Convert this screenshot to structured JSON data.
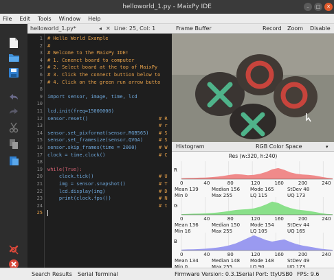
{
  "window": {
    "title": "helloworld_1.py - MaixPy IDE"
  },
  "menu": [
    "File",
    "Edit",
    "Tools",
    "Window",
    "Help"
  ],
  "editor": {
    "tab_label": "helloworld_1.py*",
    "cursor_pos": "Line: 25, Col: 1",
    "close_glyph": "✕",
    "nav_left": "◂",
    "nav_right": "▸"
  },
  "code_lines": [
    {
      "n": "1",
      "t": "# Hello World Example",
      "c": "#e8a24a"
    },
    {
      "n": "2",
      "t": "#",
      "c": "#e8a24a"
    },
    {
      "n": "3",
      "t": "# Welcome to the MaixPy IDE!",
      "c": "#e8a24a"
    },
    {
      "n": "4",
      "t": "# 1. Conenct board to computer",
      "c": "#e8a24a"
    },
    {
      "n": "5",
      "t": "# 2. Select board at the top of MaixPy",
      "c": "#e8a24a"
    },
    {
      "n": "6",
      "t": "# 3. Click the connect buttion below to",
      "c": "#e8a24a"
    },
    {
      "n": "7",
      "t": "# 4. Click on the green run arrow butto",
      "c": "#e8a24a"
    },
    {
      "n": "8",
      "t": "",
      "c": "#c0c0c0"
    },
    {
      "n": "9",
      "t": "import sensor, image, time, lcd",
      "c": "#6fa8dc"
    },
    {
      "n": "10",
      "t": "",
      "c": "#c0c0c0"
    },
    {
      "n": "11",
      "t": "lcd.init(freq=15000000)",
      "c": "#6fa8dc"
    },
    {
      "n": "12",
      "t": "sensor.reset()",
      "c": "#6fa8dc"
    },
    {
      "n": "13",
      "t": "",
      "c": "#c0c0c0"
    },
    {
      "n": "14",
      "t": "sensor.set_pixformat(sensor.RGB565)",
      "c": "#6fa8dc"
    },
    {
      "n": "15",
      "t": "sensor.set_framesize(sensor.QVGA)",
      "c": "#6fa8dc"
    },
    {
      "n": "16",
      "t": "sensor.skip_frames(time = 2000)",
      "c": "#6fa8dc"
    },
    {
      "n": "17",
      "t": "clock = time.clock()",
      "c": "#6fa8dc"
    },
    {
      "n": "18",
      "t": "",
      "c": "#c0c0c0"
    },
    {
      "n": "19",
      "t": "while(True):",
      "c": "#d06070"
    },
    {
      "n": "20",
      "t": "    clock.tick()",
      "c": "#6fa8dc"
    },
    {
      "n": "21",
      "t": "    img = sensor.snapshot()",
      "c": "#6fa8dc"
    },
    {
      "n": "22",
      "t": "    lcd.display(img)",
      "c": "#6fa8dc"
    },
    {
      "n": "23",
      "t": "    print(clock.fps())",
      "c": "#6fa8dc"
    },
    {
      "n": "24",
      "t": "",
      "c": "#c0c0c0"
    },
    {
      "n": "25",
      "t": "",
      "c": "#c0c0c0"
    }
  ],
  "trailing_comments": [
    "# R",
    "# r",
    "# S",
    "# S",
    "# W",
    "# C",
    "# U",
    "# T",
    "# D",
    "# N",
    "# t"
  ],
  "framebuffer": {
    "title": "Frame Buffer",
    "record": "Record",
    "zoom": "Zoom",
    "disable": "Disable"
  },
  "histogram": {
    "title": "Histogram",
    "colorspace": "RGB Color Space",
    "resolution": "Res (w:320, h:240)",
    "x_ticks": [
      "0",
      "40",
      "80",
      "120",
      "160",
      "200",
      "240"
    ],
    "stat_labels": [
      "Mean",
      "Median",
      "Mode",
      "StDev",
      "Min",
      "Max",
      "LQ",
      "UQ"
    ],
    "channels": [
      {
        "name": "R",
        "color": "#f08a8a",
        "mean": "139",
        "median": "156",
        "mode": "165",
        "stdev": "48",
        "min": "0",
        "max": "255",
        "lq": "115",
        "uq": "173"
      },
      {
        "name": "G",
        "color": "#8ae08a",
        "mean": "136",
        "median": "150",
        "mode": "154",
        "stdev": "44",
        "min": "16",
        "max": "255",
        "lq": "105",
        "uq": "165"
      },
      {
        "name": "B",
        "color": "#9a9af0",
        "mean": "134",
        "median": "148",
        "mode": "148",
        "stdev": "49",
        "min": "0",
        "max": "255",
        "lq": "90",
        "uq": "173"
      }
    ]
  },
  "status": {
    "search_results": "Search Results",
    "serial_terminal": "Serial Terminal",
    "firmware": "Firmware Version: 0.3.1",
    "serial_port": "Serial Port: ttyUSB0",
    "fps": "FPS:   9.6"
  },
  "colors": {
    "accent": "#2a7fd4",
    "titlebar": "#3a3a3a",
    "close": "#e05a2b",
    "editor_bg": "#1e1e1e"
  }
}
